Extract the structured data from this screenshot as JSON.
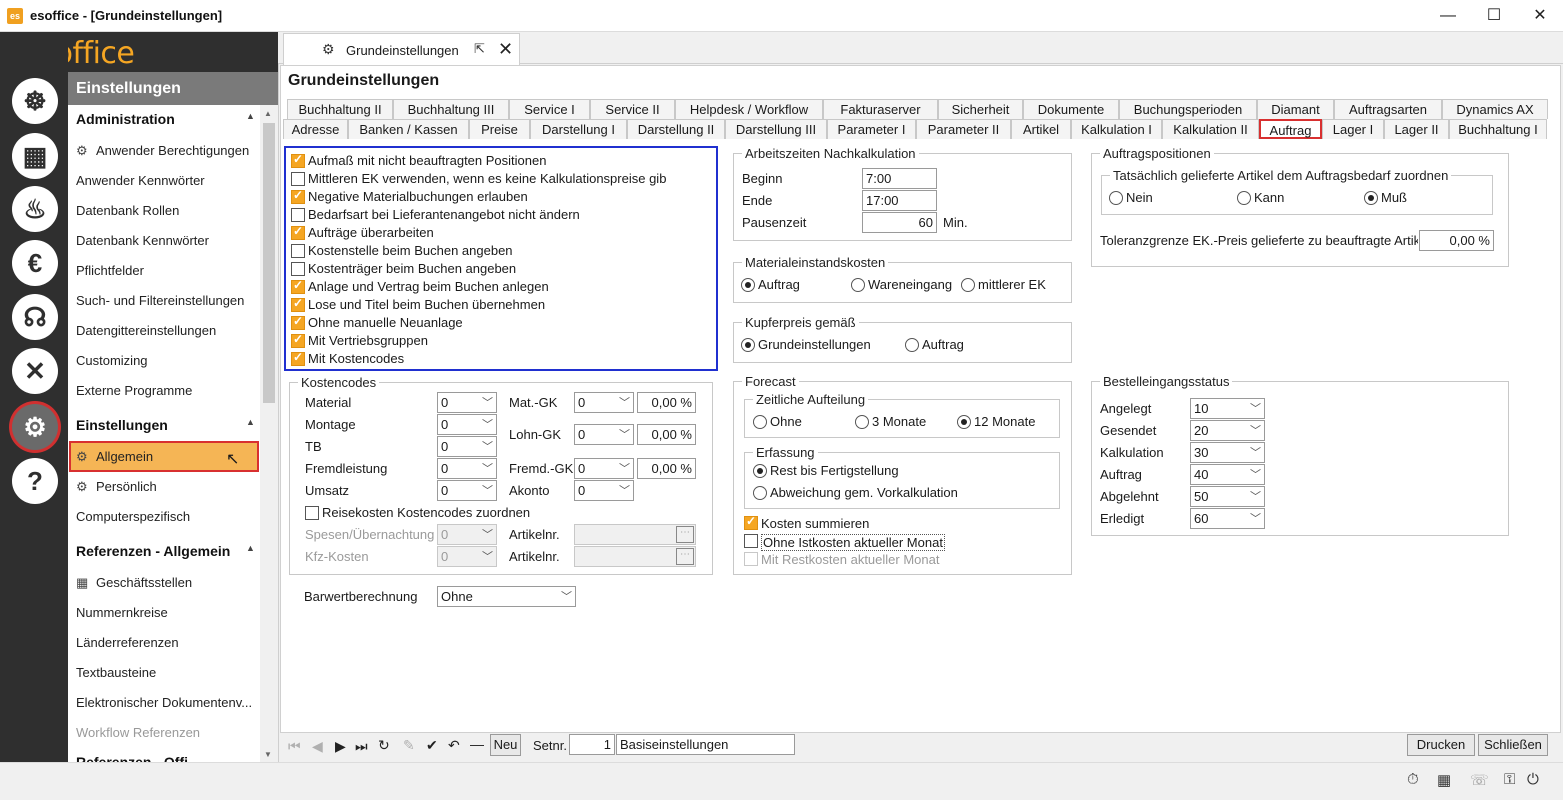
{
  "window": {
    "title": "esoffice - [Grundeinstellungen]",
    "minimize": "—",
    "maximize": "☐",
    "close": "✕"
  },
  "logo": "esoffice",
  "rail": {
    "icons": [
      "helm-icon",
      "building-icon",
      "alarm-icon",
      "euro-icon",
      "headset-icon",
      "tools-icon",
      "settings-gears-icon",
      "help-icon"
    ]
  },
  "nav": {
    "header": "Einstellungen",
    "sections": [
      {
        "title": "Administration",
        "items": [
          "Anwender Berechtigungen",
          "Anwender Kennwörter",
          "Datenbank Rollen",
          "Datenbank Kennwörter",
          "Pflichtfelder",
          "Such- und Filtereinstellungen",
          "Datengittereinstellungen",
          "Customizing",
          "Externe Programme"
        ]
      },
      {
        "title": "Einstellungen",
        "items": [
          "Allgemein",
          "Persönlich",
          "Computerspezifisch"
        ]
      },
      {
        "title": "Referenzen - Allgemein",
        "items": [
          "Geschäftsstellen",
          "Nummernkreise",
          "Länderreferenzen",
          "Textbausteine",
          "Elektronischer Dokumentenv...",
          "Workflow Referenzen"
        ]
      },
      {
        "title": "Referenzen - Offi"
      }
    ]
  },
  "doctab": {
    "label": "Grundeinstellungen"
  },
  "page_title": "Grundeinstellungen",
  "tabs_row1": [
    "Buchhaltung II",
    "Buchhaltung III",
    "Service I",
    "Service II",
    "Helpdesk / Workflow",
    "Fakturaserver",
    "Sicherheit",
    "Dokumente",
    "Buchungsperioden",
    "Diamant",
    "Auftragsarten",
    "Dynamics AX"
  ],
  "tabs_row2": [
    "Adresse",
    "Banken / Kassen",
    "Preise",
    "Darstellung I",
    "Darstellung II",
    "Darstellung III",
    "Parameter I",
    "Parameter II",
    "Artikel",
    "Kalkulation I",
    "Kalkulation II",
    "Auftrag",
    "Lager I",
    "Lager II",
    "Buchhaltung I"
  ],
  "options": [
    {
      "label": "Aufmaß mit nicht beauftragten Positionen",
      "checked": true
    },
    {
      "label": "Mittleren EK verwenden, wenn es keine Kalkulationspreise gib",
      "checked": false
    },
    {
      "label": "Negative Materialbuchungen erlauben",
      "checked": true
    },
    {
      "label": "Bedarfsart bei Lieferantenangebot nicht ändern",
      "checked": false
    },
    {
      "label": "Aufträge überarbeiten",
      "checked": true
    },
    {
      "label": "Kostenstelle beim Buchen angeben",
      "checked": false
    },
    {
      "label": "Kostenträger beim Buchen angeben",
      "checked": false
    },
    {
      "label": "Anlage und Vertrag beim Buchen anlegen",
      "checked": true
    },
    {
      "label": "Lose und Titel beim Buchen übernehmen",
      "checked": true
    },
    {
      "label": "Ohne manuelle Neuanlage",
      "checked": true
    },
    {
      "label": "Mit Vertriebsgruppen",
      "checked": true
    },
    {
      "label": "Mit Kostencodes",
      "checked": true
    }
  ],
  "kostencodes": {
    "title": "Kostencodes",
    "left": [
      {
        "label": "Material",
        "value": "0"
      },
      {
        "label": "Montage",
        "value": "0"
      },
      {
        "label": "TB",
        "value": "0"
      },
      {
        "label": "Fremdleistung",
        "value": "0"
      },
      {
        "label": "Umsatz",
        "value": "0"
      }
    ],
    "right": [
      {
        "label": "Mat.-GK",
        "value": "0",
        "pct": "0,00 %"
      },
      {
        "label": "Lohn-GK",
        "value": "0",
        "pct": "0,00 %"
      },
      {
        "label": "Fremd.-GK",
        "value": "0",
        "pct": "0,00 %"
      },
      {
        "label": "Akonto",
        "value": "0"
      }
    ],
    "reise_label": "Reisekosten Kostencodes zuordnen",
    "spesen_label": "Spesen/Übernachtung",
    "spesen_value": "0",
    "kfz_label": "Kfz-Kosten",
    "kfz_value": "0",
    "artikel_label1": "Artikelnr.",
    "artikel_label2": "Artikelnr.",
    "dots": "⋯"
  },
  "barwert": {
    "label": "Barwertberechnung",
    "value": "Ohne"
  },
  "arbeitszeiten": {
    "title": "Arbeitszeiten Nachkalkulation",
    "beginn_label": "Beginn",
    "beginn": "7:00",
    "ende_label": "Ende",
    "ende": "17:00",
    "pause_label": "Pausenzeit",
    "pause": "60",
    "unit": "Min."
  },
  "materialeinstand": {
    "title": "Materialeinstandskosten",
    "options": [
      "Auftrag",
      "Wareneingang",
      "mittlerer EK"
    ],
    "selected": 0
  },
  "kupferpreis": {
    "title": "Kupferpreis gemäß",
    "options": [
      "Grundeinstellungen",
      "Auftrag"
    ],
    "selected": 0
  },
  "forecast": {
    "title": "Forecast",
    "zeitlich_title": "Zeitliche Aufteilung",
    "zeitlich_options": [
      "Ohne",
      "3 Monate",
      "12 Monate"
    ],
    "zeitlich_selected": 2,
    "erfassung_title": "Erfassung",
    "erfassung_options": [
      "Rest bis Fertigstellung",
      "Abweichung gem. Vorkalkulation"
    ],
    "erfassung_selected": 0,
    "kosten_summieren": "Kosten summieren",
    "ohne_istkosten": "Ohne Istkosten aktueller Monat",
    "mit_restkosten": "Mit Restkosten aktueller Monat"
  },
  "auftragspositionen": {
    "title": "Auftragspositionen",
    "sub_title": "Tatsächlich gelieferte Artikel dem Auftragsbedarf zuordnen",
    "options": [
      "Nein",
      "Kann",
      "Muß"
    ],
    "selected": 2,
    "toleranz_label": "Toleranzgrenze EK.-Preis gelieferte zu beauftragte Artik",
    "toleranz_value": "0,00 %"
  },
  "bestelleingang": {
    "title": "Bestelleingangsstatus",
    "rows": [
      {
        "label": "Angelegt",
        "value": "10"
      },
      {
        "label": "Gesendet",
        "value": "20"
      },
      {
        "label": "Kalkulation",
        "value": "30"
      },
      {
        "label": "Auftrag",
        "value": "40"
      },
      {
        "label": "Abgelehnt",
        "value": "50"
      },
      {
        "label": "Erledigt",
        "value": "60"
      }
    ]
  },
  "bottombar": {
    "neu": "Neu",
    "setnr_label": "Setnr.",
    "setnr": "1",
    "set_name": "Basiseinstellungen",
    "drucken": "Drucken",
    "schliessen": "Schließen"
  },
  "colors": {
    "accent": "#f5a623",
    "selection_border": "#d83030",
    "highlight_box": "#2030d0",
    "rail": "#2f2f2f"
  }
}
